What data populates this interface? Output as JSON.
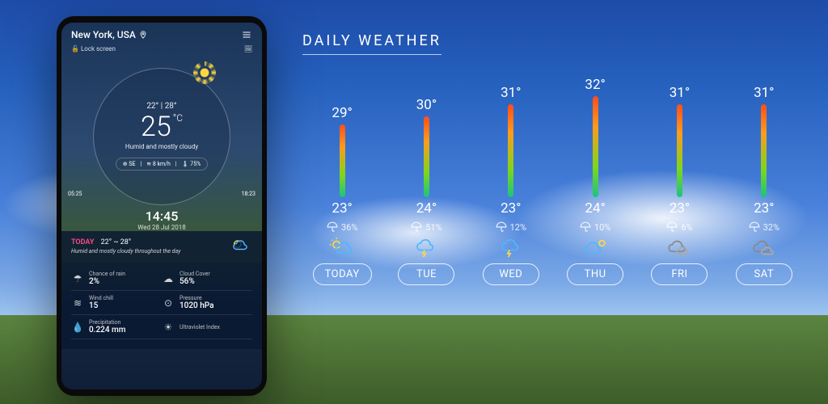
{
  "phone": {
    "location": "New York, USA",
    "lock_screen": "Lock screen",
    "range": "22° | 28°",
    "temp": "25",
    "unit": "°C",
    "condition": "Humid and mostly cloudy",
    "wind_dir": "SE",
    "wind_speed": "8 km/h",
    "humidity": "75%",
    "sunrise": "05:25",
    "sunset": "18:23",
    "time": "14:45",
    "date": "Wed 28 Jul 2018",
    "today_label": "TODAY",
    "today_range": "22° ~ 28°",
    "today_desc": "Humid and mostly cloudy throughout the day",
    "stats": [
      {
        "label": "Chance of rain",
        "value": "2%"
      },
      {
        "label": "Cloud Cover",
        "value": "56%"
      },
      {
        "label": "Wind chill",
        "value": "15"
      },
      {
        "label": "Pressure",
        "value": "1020 hPa"
      },
      {
        "label": "Precipitation",
        "value": "0.224 mm"
      },
      {
        "label": "Ultraviolet Index",
        "value": ""
      }
    ]
  },
  "daily": {
    "title": "DAILY WEATHER",
    "days": [
      {
        "label": "TODAY",
        "high": "29°",
        "low": "23°",
        "precip": "36%",
        "bar": 90,
        "icon": "sun-cloud"
      },
      {
        "label": "TUE",
        "high": "30°",
        "low": "24°",
        "precip": "51%",
        "bar": 100,
        "icon": "storm"
      },
      {
        "label": "WED",
        "high": "31°",
        "low": "23°",
        "precip": "12%",
        "bar": 115,
        "icon": "storm"
      },
      {
        "label": "THU",
        "high": "32°",
        "low": "24°",
        "precip": "10%",
        "bar": 125,
        "icon": "cloud-sun"
      },
      {
        "label": "FRI",
        "high": "31°",
        "low": "23°",
        "precip": "6%",
        "bar": 115,
        "icon": "clouds"
      },
      {
        "label": "SAT",
        "high": "31°",
        "low": "23°",
        "precip": "32%",
        "bar": 115,
        "icon": "clouds"
      }
    ]
  }
}
